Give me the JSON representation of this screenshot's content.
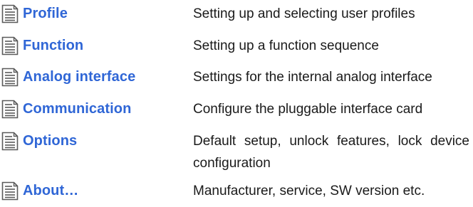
{
  "menu": {
    "items": [
      {
        "icon": "document-icon",
        "label": "Profile",
        "description": "Setting up and selecting user profiles"
      },
      {
        "icon": "document-icon",
        "label": "Function",
        "description": "Setting up a function sequence"
      },
      {
        "icon": "document-icon",
        "label": "Analog interface",
        "description": "Settings for the internal analog interface"
      },
      {
        "icon": "document-icon",
        "label": "Communication",
        "description": "Configure the pluggable interface card"
      },
      {
        "icon": "document-icon",
        "label": "Options",
        "description": "Default setup, unlock features, lock device configuration"
      },
      {
        "icon": "document-icon",
        "label": "About…",
        "description": "Manufacturer, service, SW version etc."
      }
    ]
  },
  "colors": {
    "link": "#2f66d6",
    "text": "#1a1a1a",
    "icon_stroke": "#5a5a5a"
  }
}
